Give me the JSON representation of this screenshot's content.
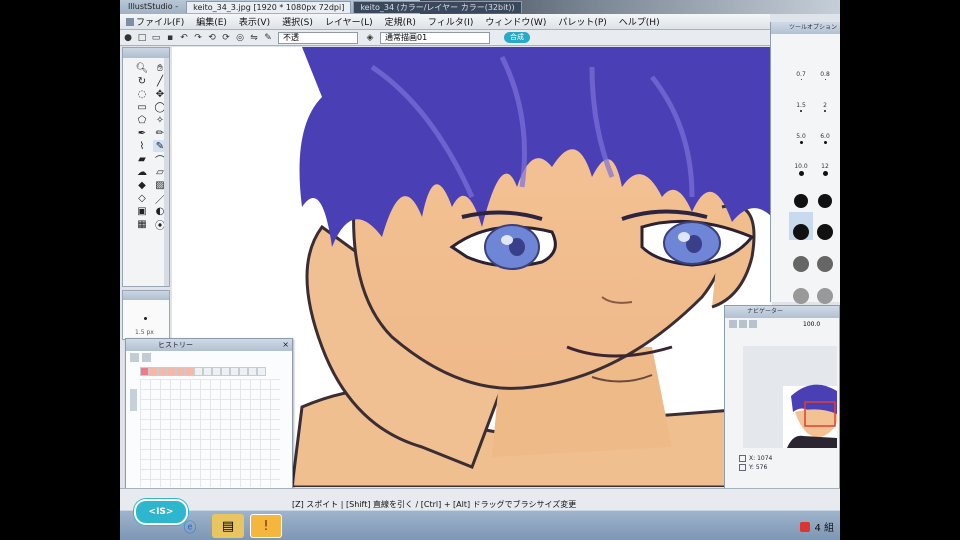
{
  "window": {
    "app_tab": "IllustStudio -",
    "file_tab_1": "keito_34_3.jpg",
    "file_tab_1_info": "[1920 * 1080px 72dpi]",
    "file_tab_2": "keito_34",
    "file_tab_2_info": "(カラー/レイヤー カラー(32bit))"
  },
  "menu": {
    "items": [
      {
        "label": "ファイル(F)"
      },
      {
        "label": "編集(E)"
      },
      {
        "label": "表示(V)"
      },
      {
        "label": "選択(S)"
      },
      {
        "label": "レイヤー(L)"
      },
      {
        "label": "定規(R)"
      },
      {
        "label": "フィルタ(I)"
      },
      {
        "label": "ウィンドウ(W)"
      },
      {
        "label": "パレット(P)"
      },
      {
        "label": "ヘルプ(H)"
      }
    ]
  },
  "options": {
    "mode_select": "不透",
    "layer_select": "通常描画01",
    "pill": "合成"
  },
  "toolbox": {
    "tools": [
      "zoom-icon",
      "hand-icon",
      "rotate-icon",
      "eyedropper-icon",
      "lasso-icon",
      "move-icon",
      "rect-select-icon",
      "ellipse-select-icon",
      "poly-select-icon",
      "wand-icon",
      "pen-icon",
      "pencil-icon",
      "brush-icon",
      "airbrush-icon",
      "marker-icon",
      "watercolor-icon",
      "blend-icon",
      "eraser-icon",
      "bucket-icon",
      "gradient-icon",
      "shape-icon",
      "line-icon",
      "text-icon",
      "balloon-icon",
      "pattern-icon",
      "dodge-icon"
    ]
  },
  "brush_preview": {
    "label": "1.5 px"
  },
  "history": {
    "title": "ヒストリー",
    "cells": [
      "hot",
      "warm",
      "warm",
      "warm",
      "warm",
      "warm",
      "plain",
      "plain",
      "plain",
      "plain",
      "plain",
      "plain",
      "plain",
      "plain"
    ]
  },
  "brush_sizes": {
    "title": "ツールオプション",
    "sizes": [
      {
        "label": "0.7",
        "d": 1,
        "tone": "big"
      },
      {
        "label": "0.8",
        "d": 1,
        "tone": "big"
      },
      {
        "label": "1.5",
        "d": 2,
        "tone": "big"
      },
      {
        "label": "2",
        "d": 2,
        "tone": "big"
      },
      {
        "label": "5.0",
        "d": 3,
        "tone": "big"
      },
      {
        "label": "6.0",
        "d": 3,
        "tone": "big"
      },
      {
        "label": "10.0",
        "d": 5,
        "tone": "big"
      },
      {
        "label": "12",
        "d": 5,
        "tone": "big"
      },
      {
        "label": "",
        "d": 14,
        "tone": "big"
      },
      {
        "label": "",
        "d": 14,
        "tone": "big"
      },
      {
        "label": "",
        "d": 16,
        "tone": "sel"
      },
      {
        "label": "",
        "d": 16,
        "tone": "big"
      },
      {
        "label": "",
        "d": 16,
        "tone": "gray"
      },
      {
        "label": "",
        "d": 16,
        "tone": "gray"
      },
      {
        "label": "",
        "d": 16,
        "tone": "lgray"
      },
      {
        "label": "",
        "d": 16,
        "tone": "lgray"
      },
      {
        "label": "",
        "d": 16,
        "tone": "xgray"
      },
      {
        "label": "",
        "d": 16,
        "tone": "xgray"
      }
    ]
  },
  "navigator": {
    "title": "ナビゲーター",
    "zoom": "100.0",
    "x_label": "X:",
    "x_value": "1074",
    "y_label": "Y:",
    "y_value": "576"
  },
  "status": {
    "text": "[Z] スポイト | [Shift] 直線を引く / [Ctrl] + [Alt] ドラッグでブラシサイズ変更"
  },
  "taskbar": {
    "clock": "4 組"
  },
  "badge": {
    "text": "<IS>"
  },
  "colors": {
    "hair": "#4b3fb5",
    "skin": "#f5c89e",
    "eye": "#6f86d6",
    "accent": "#2aa8c8"
  }
}
